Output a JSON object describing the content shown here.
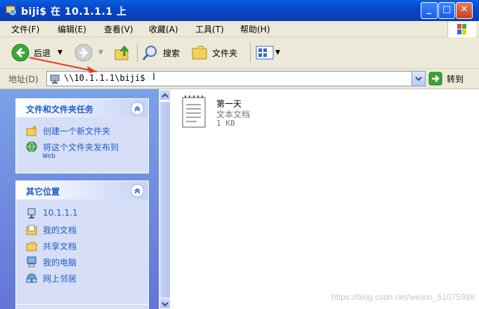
{
  "window": {
    "title": "biji$ 在 10.1.1.1 上"
  },
  "menu": [
    "文件(F)",
    "编辑(E)",
    "查看(V)",
    "收藏(A)",
    "工具(T)",
    "帮助(H)"
  ],
  "toolbar": {
    "back": "后退",
    "search": "搜索",
    "folders": "文件夹"
  },
  "address": {
    "label": "地址(D)",
    "value": "\\\\10.1.1.1\\biji$",
    "go": "转到"
  },
  "tasks": {
    "title": "文件和文件夹任务",
    "items": [
      "创建一个新文件夹",
      "将这个文件夹发布到"
    ],
    "web": "Web"
  },
  "places": {
    "title": "其它位置",
    "items": [
      "10.1.1.1",
      "我的文档",
      "共享文档",
      "我的电脑",
      "网上邻居"
    ]
  },
  "files": [
    {
      "name": "第一天",
      "type": "文本文档",
      "size": "1 KB"
    }
  ],
  "watermark": "https://blog.csdn.net/weixin_51075988",
  "colors": {
    "title": "#0a5fe0",
    "panel": "#6f8ee0",
    "link": "#215dc6",
    "annotation_arrow": "#e83a2a"
  },
  "icons": {
    "back": "back-arrow-icon",
    "forward": "forward-arrow-icon",
    "up": "folder-up-icon",
    "search": "search-icon",
    "folders": "folders-icon",
    "views": "views-icon",
    "go": "go-arrow-icon"
  }
}
